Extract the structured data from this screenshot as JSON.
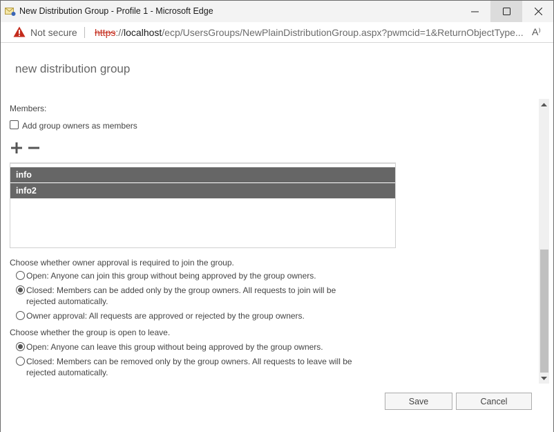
{
  "window": {
    "title": "New Distribution Group - Profile 1 - Microsoft Edge",
    "controls": {
      "minimize": "—",
      "maximize": "☐",
      "close": "✕"
    }
  },
  "addressbar": {
    "security_label": "Not secure",
    "url_scheme": "https",
    "url_sep": "://",
    "url_host": "localhost",
    "url_path": "/ecp/UsersGroups/NewPlainDistributionGroup.aspx?pwmcid=1&ReturnObjectType...",
    "read_aloud": "A⁾"
  },
  "page": {
    "title": "new distribution group",
    "members_label": "Members:",
    "add_owners_checkbox": {
      "label": "Add group owners as members",
      "checked": false
    },
    "add_member_icon": "plus-icon",
    "remove_member_icon": "minus-icon",
    "members": [
      {
        "name": "info",
        "selected": true
      },
      {
        "name": "info2",
        "selected": true
      }
    ],
    "join_section": {
      "prompt": "Choose whether owner approval is required to join the group.",
      "options": [
        {
          "line1": "Open: Anyone can join this group without being approved by the group owners.",
          "line2": "",
          "checked": false
        },
        {
          "line1": "Closed: Members can be added only by the group owners. All requests to join will be",
          "line2": "rejected automatically.",
          "checked": true
        },
        {
          "line1": "Owner approval: All requests are approved or rejected by the group owners.",
          "line2": "",
          "checked": false
        }
      ]
    },
    "leave_section": {
      "prompt": "Choose whether the group is open to leave.",
      "options": [
        {
          "line1": "Open: Anyone can leave this group without being approved by the group owners.",
          "line2": "",
          "checked": true
        },
        {
          "line1": "Closed: Members can be removed only by the group owners. All requests to leave will be",
          "line2": "rejected automatically.",
          "checked": false
        }
      ]
    },
    "scroll_position_fraction": 0.55
  },
  "buttons": {
    "save": "Save",
    "cancel": "Cancel"
  }
}
